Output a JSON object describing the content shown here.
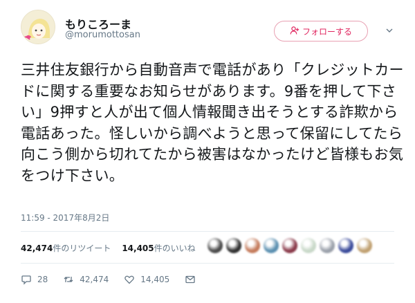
{
  "header": {
    "display_name": "もりころーま",
    "handle": "@morumottosan",
    "follow_label": "フォローする",
    "follow_icon": "add-user-icon",
    "caret_icon": "chevron-down-icon"
  },
  "tweet": {
    "text": "三井住友銀行から自動音声で電話があり「クレジットカードに関する重要なお知らせがあります。9番を押して下さい」9押すと人が出て個人情報聞き出そうとする詐欺から電話あった。怪しいから調べようと思って保留にしてたら向こう側から切れてたから被害はなかったけど皆様もお気をつけ下さい。",
    "timestamp": "11:59 - 2017年8月2日"
  },
  "stats": {
    "retweets_count": "42,474",
    "retweets_label": "件のリツイート",
    "likes_count": "14,405",
    "likes_label": "件のいいね"
  },
  "likers": [
    {
      "color": "#4a4a4a"
    },
    {
      "color": "#2f2f2f"
    },
    {
      "color": "#c47a5a"
    },
    {
      "color": "#5a8fb0"
    },
    {
      "color": "#8a3a4a"
    },
    {
      "color": "#c8d8c8"
    },
    {
      "color": "#9aa0aa"
    },
    {
      "color": "#3a4a9a"
    },
    {
      "color": "#c0a070"
    }
  ],
  "actions": {
    "reply_count": "28",
    "retweet_count": "42,474",
    "like_count": "14,405",
    "reply_icon": "reply-icon",
    "retweet_icon": "retweet-icon",
    "like_icon": "heart-icon",
    "dm_icon": "envelope-icon"
  },
  "colors": {
    "accent": "#e0245e",
    "muted": "#657786",
    "text": "#14171a",
    "divider": "#e6ecf0"
  }
}
